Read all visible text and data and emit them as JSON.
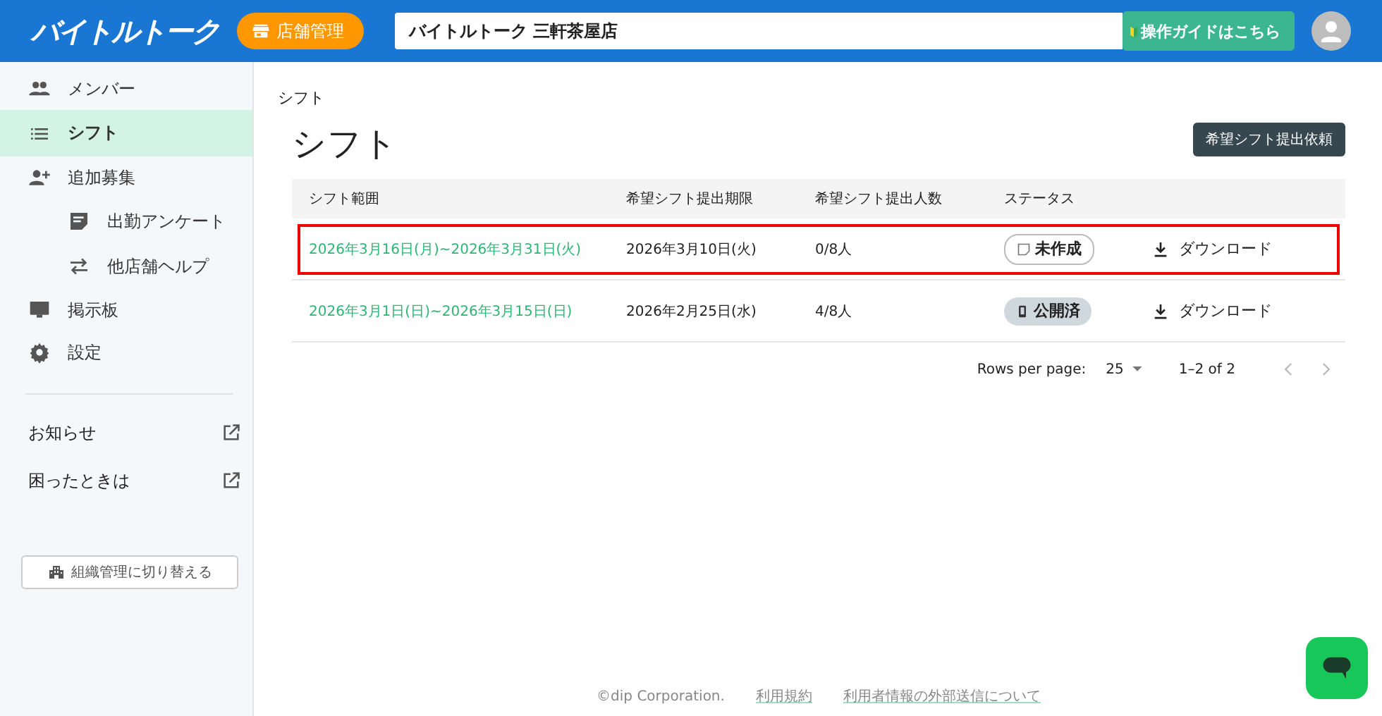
{
  "header": {
    "logo": "バイトルトーク",
    "store_button": "店舗管理",
    "store_name": "バイトルトーク 三軒茶屋店",
    "guide_button": "操作ガイドはこちら"
  },
  "sidebar": {
    "items": [
      {
        "label": "メンバー",
        "selected": false
      },
      {
        "label": "シフト",
        "selected": true
      },
      {
        "label": "追加募集",
        "selected": false,
        "children": [
          {
            "label": "出勤アンケート",
            "selected": false
          },
          {
            "label": "他店舗ヘルプ",
            "selected": false
          }
        ]
      },
      {
        "label": "掲示板",
        "selected": false
      },
      {
        "label": "設定",
        "selected": false
      }
    ],
    "links": [
      "お知らせ",
      "困ったときは"
    ],
    "switch_button": "組織管理に切り替える"
  },
  "breadcrumb": "シフト",
  "title": "シフト",
  "request_button": "希望シフト提出依頼",
  "table": {
    "columns": [
      "シフト範囲",
      "希望シフト提出期限",
      "希望シフト提出人数",
      "ステータス"
    ],
    "rows": [
      {
        "range": "2026年3月16日(月)~2026年3月31日(火)",
        "deadline": "2026年3月10日(火)",
        "count": "0/8人",
        "status": {
          "kind": "draft",
          "label": "未作成"
        },
        "action": "ダウンロード",
        "highlighted": true
      },
      {
        "range": "2026年3月1日(日)~2026年3月15日(日)",
        "deadline": "2026年2月25日(水)",
        "count": "4/8人",
        "status": {
          "kind": "published",
          "label": "公開済"
        },
        "action": "ダウンロード",
        "highlighted": false
      }
    ]
  },
  "pagination": {
    "rows_label": "Rows per page:",
    "rows_value": "25",
    "range": "1–2 of 2"
  },
  "footer": [
    "©dip Corporation.",
    "利用規約",
    "利用者情報の外部送信について"
  ]
}
